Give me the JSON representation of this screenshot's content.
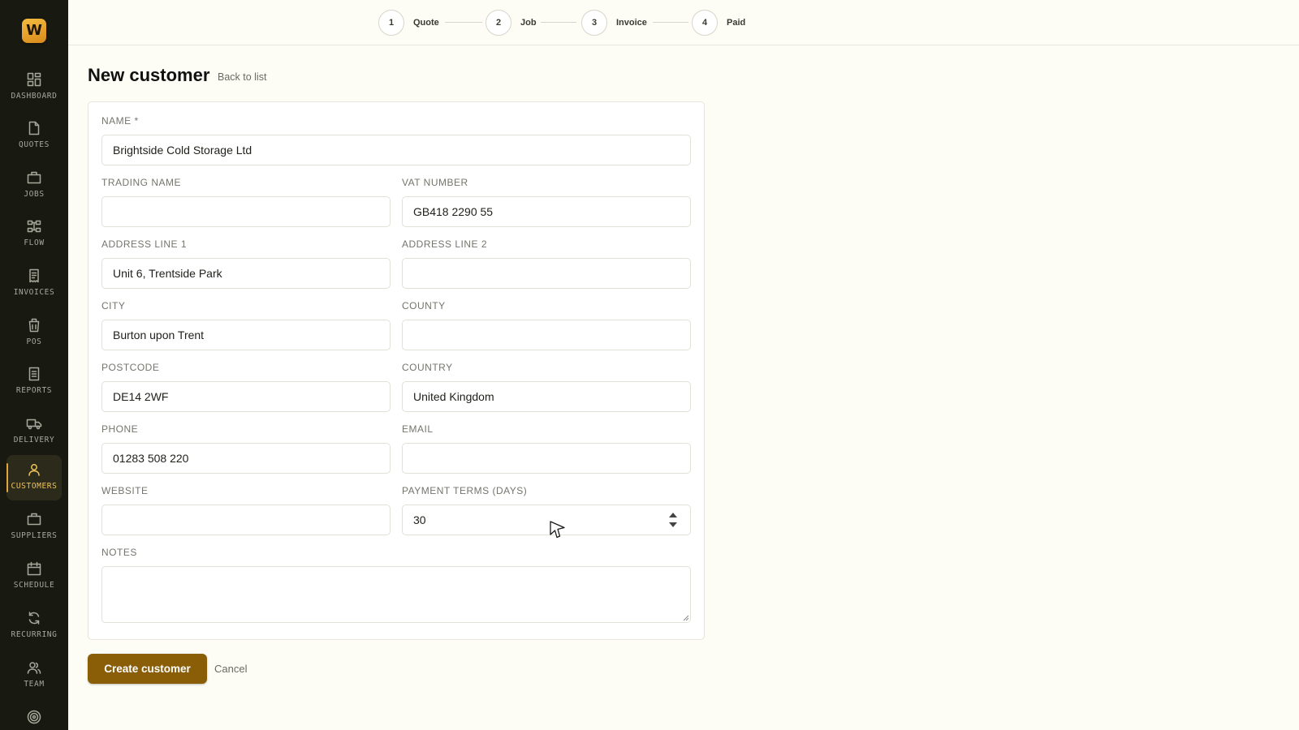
{
  "app": {
    "logo_letter": "W",
    "brand_color": "#e8a830",
    "accent_color": "#8a5d07"
  },
  "sidebar": {
    "items": [
      {
        "label": "DASHBOARD",
        "icon": "dashboard-icon"
      },
      {
        "label": "QUOTES",
        "icon": "document-icon"
      },
      {
        "label": "JOBS",
        "icon": "briefcase-icon"
      },
      {
        "label": "FLOW",
        "icon": "flow-icon"
      },
      {
        "label": "INVOICES",
        "icon": "invoice-icon"
      },
      {
        "label": "POS",
        "icon": "pos-icon"
      },
      {
        "label": "REPORTS",
        "icon": "report-icon"
      },
      {
        "label": "DELIVERY",
        "icon": "truck-icon"
      },
      {
        "label": "CUSTOMERS",
        "icon": "user-icon",
        "active": true
      },
      {
        "label": "SUPPLIERS",
        "icon": "briefcase-icon"
      },
      {
        "label": "SCHEDULE",
        "icon": "calendar-icon"
      },
      {
        "label": "RECURRING",
        "icon": "refresh-icon"
      },
      {
        "label": "TEAM",
        "icon": "team-icon"
      },
      {
        "label": "",
        "icon": "target-icon"
      }
    ]
  },
  "stepper": {
    "steps": [
      {
        "num": "1",
        "label": "Quote"
      },
      {
        "num": "2",
        "label": "Job"
      },
      {
        "num": "3",
        "label": "Invoice"
      },
      {
        "num": "4",
        "label": "Paid"
      }
    ]
  },
  "page": {
    "title": "New customer",
    "back_link": "Back to list"
  },
  "form": {
    "name": {
      "label": "NAME *",
      "value": "Brightside Cold Storage Ltd"
    },
    "trading_name": {
      "label": "TRADING NAME",
      "value": ""
    },
    "vat_number": {
      "label": "VAT NUMBER",
      "value": "GB418 2290 55"
    },
    "address_line_1": {
      "label": "ADDRESS LINE 1",
      "value": "Unit 6, Trentside Park"
    },
    "address_line_2": {
      "label": "ADDRESS LINE 2",
      "value": ""
    },
    "city": {
      "label": "CITY",
      "value": "Burton upon Trent"
    },
    "county": {
      "label": "COUNTY",
      "value": ""
    },
    "postcode": {
      "label": "POSTCODE",
      "value": "DE14 2WF"
    },
    "country": {
      "label": "COUNTRY",
      "value": "United Kingdom"
    },
    "phone": {
      "label": "PHONE",
      "value": "01283 508 220"
    },
    "email": {
      "label": "EMAIL",
      "value": ""
    },
    "website": {
      "label": "WEBSITE",
      "value": ""
    },
    "payment_terms": {
      "label": "PAYMENT TERMS (DAYS)",
      "value": "30"
    },
    "notes": {
      "label": "NOTES",
      "value": ""
    }
  },
  "actions": {
    "submit_label": "Create customer",
    "cancel_label": "Cancel"
  }
}
